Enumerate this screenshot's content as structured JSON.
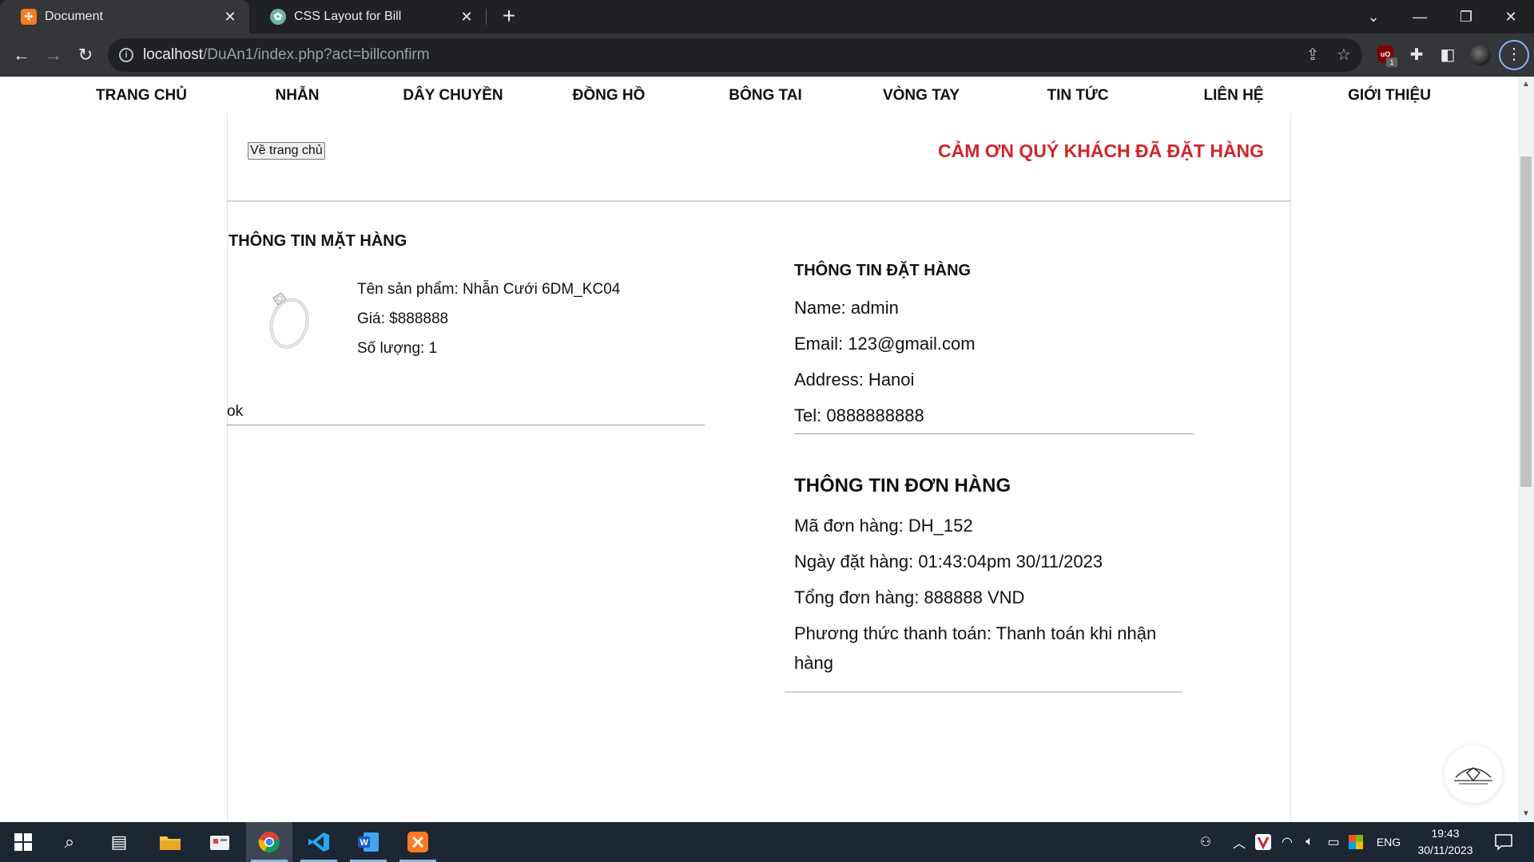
{
  "browser": {
    "tabs": [
      {
        "title": "Document",
        "icon": "xampp-icon",
        "active": true
      },
      {
        "title": "CSS Layout for Bill",
        "icon": "chatgpt-icon",
        "active": false
      }
    ],
    "url_host": "localhost",
    "url_path": "/DuAn1/index.php?act=billconfirm",
    "ublock_count": "1"
  },
  "nav": {
    "items": [
      "TRANG CHỦ",
      "NHẪN",
      "DÂY CHUYỀN",
      "ĐỒNG HỒ",
      "BÔNG TAI",
      "VÒNG TAY",
      "TIN TỨC",
      "LIÊN HỆ",
      "GIỚI THIỆU"
    ]
  },
  "header": {
    "home_button": "Về trang chủ",
    "thanks": "CẢM ƠN QUÝ KHÁCH ĐÃ ĐẶT HÀNG"
  },
  "product_section": {
    "title": "THÔNG TIN MẶT HÀNG",
    "name_line": "Tên sản phẩm: Nhẫn Cưới 6DM_KC04",
    "price_line": "Giá: $888888",
    "qty_line": "Số lượng: 1",
    "status": "ok"
  },
  "customer_section": {
    "title": "THÔNG TIN ĐẶT HÀNG",
    "name": "Name: admin",
    "email": "Email: 123@gmail.com",
    "address": "Address: Hanoi",
    "tel": "Tel: 0888888888"
  },
  "order_section": {
    "title": "THÔNG TIN ĐƠN HÀNG",
    "code": "Mã đơn hàng: DH_152",
    "date": "Ngày đặt hàng: 01:43:04pm 30/11/2023",
    "total": "Tổng đơn hàng: 888888 VND",
    "payment_line1": "Phương thức thanh toán: Thanh toán khi nhận",
    "payment_line2": "hàng"
  },
  "taskbar": {
    "lang": "ENG",
    "time": "19:43",
    "date": "30/11/2023"
  },
  "colors": {
    "accent_red": "#d0262b",
    "chrome_dark": "#202124",
    "chrome_toolbar": "#35363a",
    "taskbar": "#1d2633"
  }
}
